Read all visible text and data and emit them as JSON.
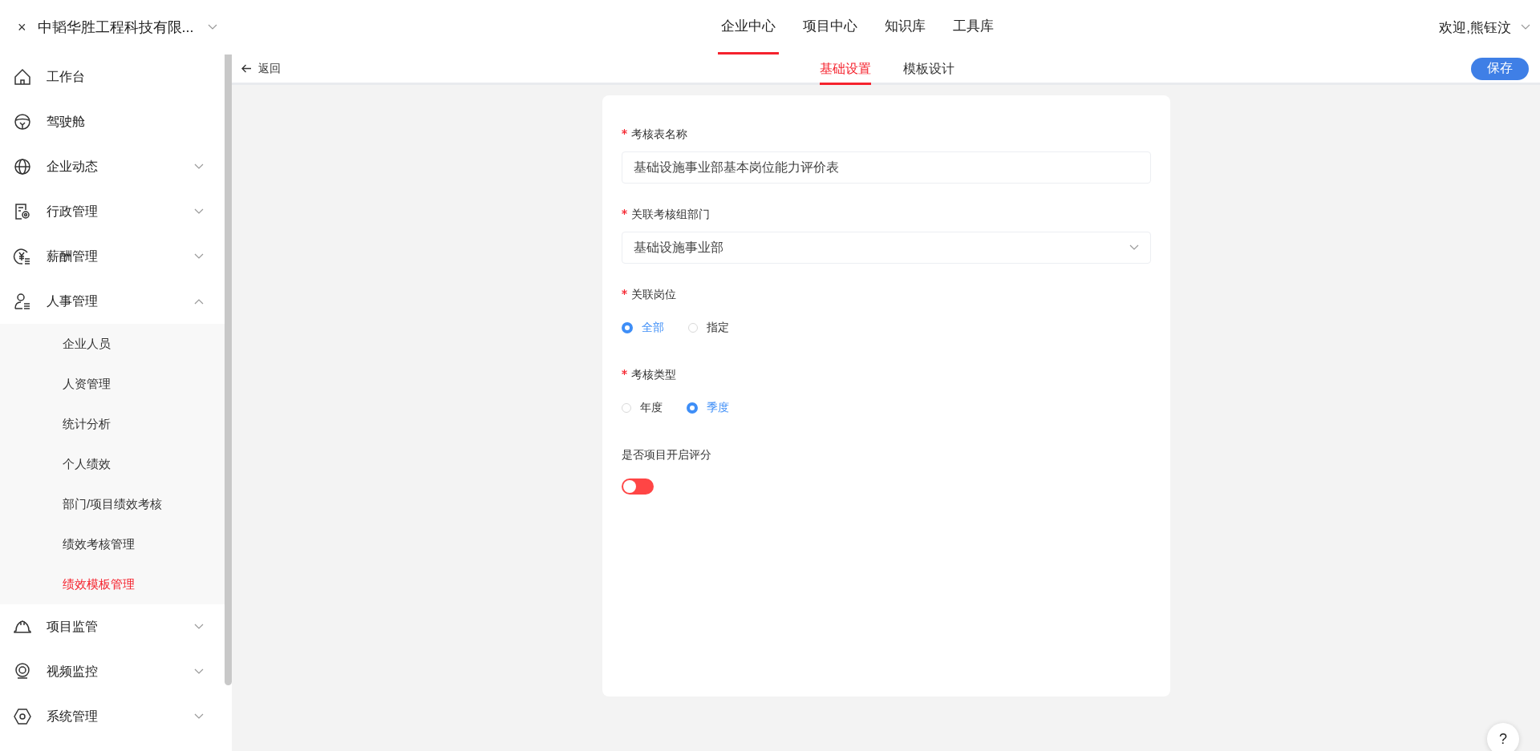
{
  "header": {
    "close": "×",
    "company": "中韬华胜工程科技有限...",
    "nav": [
      {
        "label": "企业中心",
        "selected": true
      },
      {
        "label": "项目中心",
        "selected": false
      },
      {
        "label": "知识库",
        "selected": false
      },
      {
        "label": "工具库",
        "selected": false
      }
    ],
    "user": "欢迎,熊钰汶"
  },
  "sidebar": {
    "items": [
      {
        "label": "工作台",
        "kind": "link"
      },
      {
        "label": "驾驶舱",
        "kind": "link"
      },
      {
        "label": "企业动态",
        "kind": "group",
        "expanded": false
      },
      {
        "label": "行政管理",
        "kind": "group",
        "expanded": false
      },
      {
        "label": "薪酬管理",
        "kind": "group",
        "expanded": false
      },
      {
        "label": "人事管理",
        "kind": "group",
        "expanded": true,
        "children": [
          {
            "label": "企业人员",
            "selected": false
          },
          {
            "label": "人资管理",
            "selected": false
          },
          {
            "label": "统计分析",
            "selected": false
          },
          {
            "label": "个人绩效",
            "selected": false
          },
          {
            "label": "部门/项目绩效考核",
            "selected": false
          },
          {
            "label": "绩效考核管理",
            "selected": false
          },
          {
            "label": "绩效模板管理",
            "selected": true
          }
        ]
      },
      {
        "label": "项目监管",
        "kind": "group",
        "expanded": false
      },
      {
        "label": "视频监控",
        "kind": "group",
        "expanded": false
      },
      {
        "label": "系统管理",
        "kind": "group",
        "expanded": false
      }
    ]
  },
  "subbar": {
    "back": "返回",
    "tabs": [
      {
        "label": "基础设置",
        "selected": true
      },
      {
        "label": "模板设计",
        "selected": false
      }
    ],
    "save": "保存"
  },
  "form": {
    "fields": [
      {
        "kind": "text",
        "label": "考核表名称",
        "required": true,
        "value": "基础设施事业部基本岗位能力评价表"
      },
      {
        "kind": "select",
        "label": "关联考核组部门",
        "required": true,
        "value": "基础设施事业部"
      },
      {
        "kind": "radio",
        "label": "关联岗位",
        "required": true,
        "options": [
          {
            "label": "全部",
            "selected": true
          },
          {
            "label": "指定",
            "selected": false
          }
        ]
      },
      {
        "kind": "radio",
        "label": "考核类型",
        "required": true,
        "options": [
          {
            "label": "年度",
            "selected": false
          },
          {
            "label": "季度",
            "selected": true
          }
        ]
      },
      {
        "kind": "switch",
        "label": "是否项目开启评分",
        "required": false,
        "on": false
      }
    ]
  },
  "help": "?"
}
